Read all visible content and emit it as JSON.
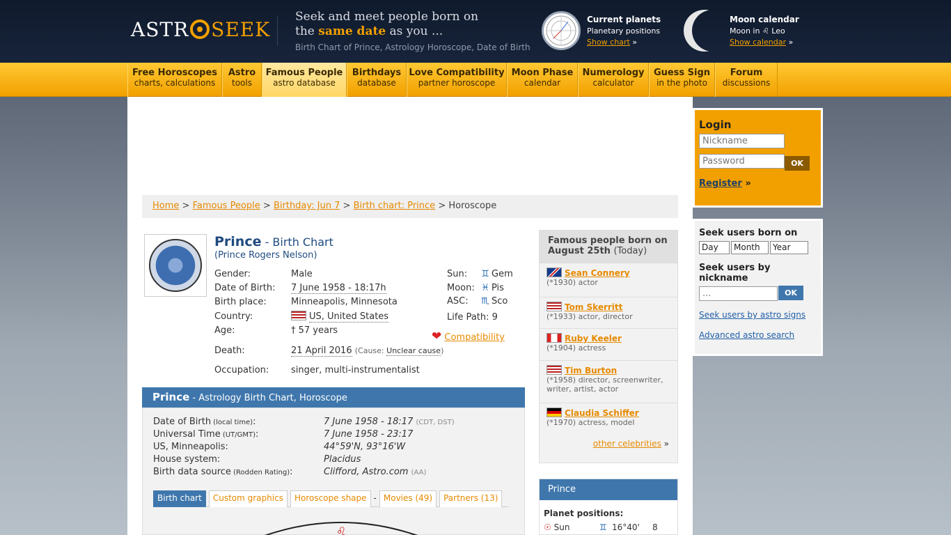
{
  "header": {
    "logo_astro": "ASTR",
    "logo_seek": "SEEK",
    "tagline_1": "Seek and meet people born on",
    "tagline_2a": "the ",
    "tagline_2b": "same date",
    "tagline_2c": " as you ...",
    "tagline_3": "Birth Chart of Prince, Astrology Horoscope, Date of Birth",
    "planets_title": "Current planets",
    "planets_sub": "Planetary positions",
    "planets_link": "Show chart",
    "moon_title": "Moon calendar",
    "moon_sub": "Moon in ♌ Leo",
    "moon_link": "Show calendar",
    "arrow": "»"
  },
  "nav": [
    {
      "title": "Free Horoscopes",
      "sub": "charts, calculations"
    },
    {
      "title": "Astro",
      "sub": "tools"
    },
    {
      "title": "Famous People",
      "sub": "astro database"
    },
    {
      "title": "Birthdays",
      "sub": "database"
    },
    {
      "title": "Love Compatibility",
      "sub": "partner horoscope"
    },
    {
      "title": "Moon Phase",
      "sub": "calendar"
    },
    {
      "title": "Numerology",
      "sub": "calculator"
    },
    {
      "title": "Guess Sign",
      "sub": "in the photo"
    },
    {
      "title": "Forum",
      "sub": "discussions"
    }
  ],
  "breadcrumb": {
    "home": "Home",
    "famous": "Famous People",
    "birthday": "Birthday: Jun 7",
    "chart": "Birth chart: Prince",
    "current": "Horoscope",
    "sep": ">"
  },
  "profile": {
    "name": "Prince",
    "name_suffix": " - Birth Chart",
    "full_name": "(Prince Rogers Nelson)",
    "gender_k": "Gender:",
    "gender": "Male",
    "dob_k": "Date of Birth:",
    "dob": "7 June 1958 - 18:17h",
    "place_k": "Birth place:",
    "place": "Minneapolis, Minnesota",
    "country_k": "Country:",
    "country": "US, United States",
    "age_k": "Age:",
    "age": "† 57 years",
    "death_k": "Death:",
    "death": "21 April 2016",
    "death_cause_pre": "(Cause: ",
    "death_cause": "Unclear cause",
    "death_cause_post": ")",
    "occ_k": "Occupation:",
    "occ": "singer, multi-instrumentalist",
    "sun_k": "Sun:",
    "sun": "Gem",
    "sun_sym": "♊",
    "moon_k": "Moon:",
    "moon": "Pis",
    "moon_sym": "♓",
    "asc_k": "ASC:",
    "asc": "Sco",
    "asc_sym": "♏",
    "life_path": "Life Path: 9",
    "compat": "Compatibility"
  },
  "chartbar": {
    "name": "Prince",
    "rest": " - Astrology Birth Chart, Horoscope"
  },
  "chartinfo": [
    {
      "k": "Date of Birth",
      "small": " (local time)",
      "c": ":",
      "v": "7 June 1958 - 18:17",
      "extra": "(CDT, DST)"
    },
    {
      "k": "Universal Time",
      "small": " (UT/GMT)",
      "c": ":",
      "v": "7 June 1958 - 23:17",
      "extra": ""
    },
    {
      "k": "US, Minneapolis:",
      "small": "",
      "c": "",
      "v": "44°59'N, 93°16'W",
      "extra": ""
    },
    {
      "k": "House system:",
      "small": "",
      "c": "",
      "v": "Placidus",
      "extra": ""
    },
    {
      "k": "Birth data source",
      "small": " (Rodden Rating)",
      "c": ":",
      "v": "Clifford, Astro.com",
      "extra": "(AA)"
    }
  ],
  "tabs": [
    "Birth chart",
    "Custom graphics",
    "Horoscope shape",
    "-",
    "Movies (49)",
    "Partners (13)"
  ],
  "famous": {
    "title": "Famous people born on August 25th",
    "today": "(Today)",
    "people": [
      {
        "name": "Sean Connery",
        "desc": "(*1930) actor"
      },
      {
        "name": "Tom Skerritt",
        "desc": "(*1933) actor, director"
      },
      {
        "name": "Ruby Keeler",
        "desc": "(*1904) actress"
      },
      {
        "name": "Tim Burton",
        "desc": "(*1958) director, screenwriter, writer, artist, actor"
      },
      {
        "name": "Claudia Schiffer",
        "desc": "(*1970) actress, model"
      }
    ],
    "other": "other celebrities",
    "arrow": "»"
  },
  "planets": {
    "title": "Prince",
    "label": "Planet positions:",
    "sun": "Sun",
    "sun_pos": "16°40'",
    "sun_house": "8",
    "sun_sym": "♊"
  },
  "login": {
    "title": "Login",
    "nick_ph": "Nickname",
    "pass_ph": "Password",
    "ok": "OK",
    "register": "Register",
    "arrow": "»"
  },
  "seek": {
    "born": "Seek users born on",
    "day": "Day",
    "month": "Month",
    "year": "Year",
    "by_nick": "Seek users by nickname",
    "nick_ph": "...",
    "ok": "OK",
    "signs": "Seek users by astro signs",
    "advanced": "Advanced astro search"
  }
}
